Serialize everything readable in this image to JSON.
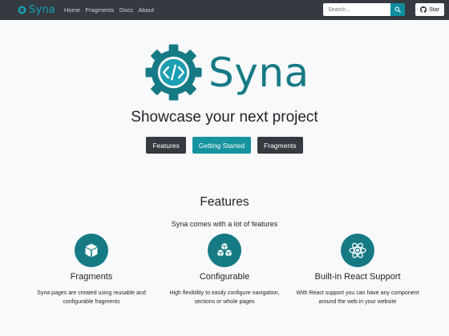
{
  "navbar": {
    "brand": "Syna",
    "links": [
      "Home",
      "Fragments",
      "Docs",
      "About"
    ],
    "search_placeholder": "Search...",
    "star_label": "Star"
  },
  "hero": {
    "name": "Syna",
    "tagline": "Showcase your next project",
    "buttons": [
      "Features",
      "Getting Started",
      "Fragments"
    ]
  },
  "features": {
    "title": "Features",
    "subtitle": "Syna comes with a lot of features",
    "items": [
      {
        "title": "Fragments",
        "description": "Syna pages are created using reusable and configurable fragments",
        "icon": "cube-icon"
      },
      {
        "title": "Configurable",
        "description": "High flexibility to easily configure navigation, sections or whole pages",
        "icon": "cubes-icon"
      },
      {
        "title": "Built-in React Support",
        "description": "With React support you can have any component around the web in your website",
        "icon": "react-icon"
      }
    ]
  },
  "colors": {
    "navbar_bg": "#343a40",
    "brand_teal": "#167a85",
    "accent": "#17a2b8",
    "button_dark": "#343a40",
    "button_teal": "#15939f",
    "page_bg": "#f8f9fa"
  }
}
